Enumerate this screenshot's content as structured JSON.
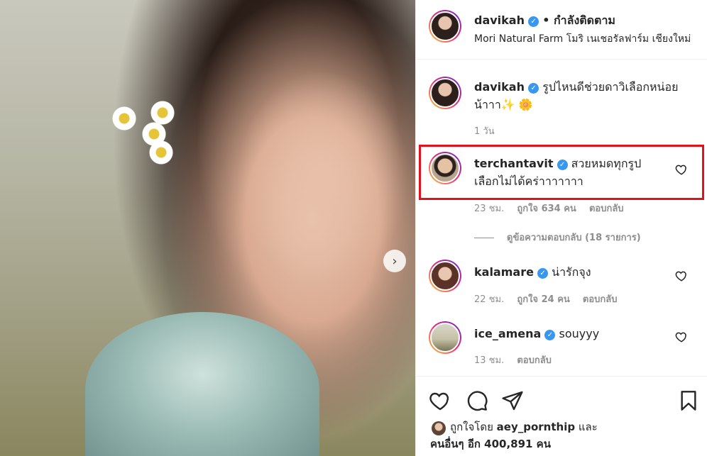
{
  "post": {
    "author": "davikah",
    "follow_status": "• กำลังติดตาม",
    "location": "Mori Natural Farm โมริ เนเชอรัลฟาร์ม เชียงใหม่"
  },
  "caption": {
    "username": "davikah",
    "text_line1": "รูปไหนดีช่วยดาวิเลือกหน่อย",
    "text_line2": "น้าาา✨ 🌼",
    "time": "1 วัน"
  },
  "comments": [
    {
      "username": "terchantavit",
      "text_line1": "สวยหมดทุกรูป",
      "text_line2": "เลือกไม่ได้คร่าาาาาาา",
      "time": "23 ชม.",
      "likes": "ถูกใจ 634 คน",
      "reply": "ตอบกลับ",
      "view_replies": "ดูข้อความตอบกลับ (18 รายการ)"
    },
    {
      "username": "kalamare",
      "text_line1": "น่ารักจุง",
      "time": "22 ชม.",
      "likes": "ถูกใจ 24 คน",
      "reply": "ตอบกลับ"
    },
    {
      "username": "ice_amena",
      "text_line1": "souyyy",
      "time": "13 ชม.",
      "reply": "ตอบกลับ"
    }
  ],
  "liked_by": {
    "prefix": "ถูกใจโดย",
    "user": "aey_pornthip",
    "and": "และ",
    "others": "คนอื่นๆ อีก 400,891 คน"
  },
  "icons": {
    "verified": "verified-badge-icon",
    "like": "heart-icon",
    "comment": "comment-bubble-icon",
    "share": "paper-plane-icon",
    "save": "bookmark-icon",
    "next": "chevron-right-icon"
  },
  "colors": {
    "highlight": "#e0121b",
    "verified": "#3897f0",
    "muted": "#8e8e8e"
  }
}
